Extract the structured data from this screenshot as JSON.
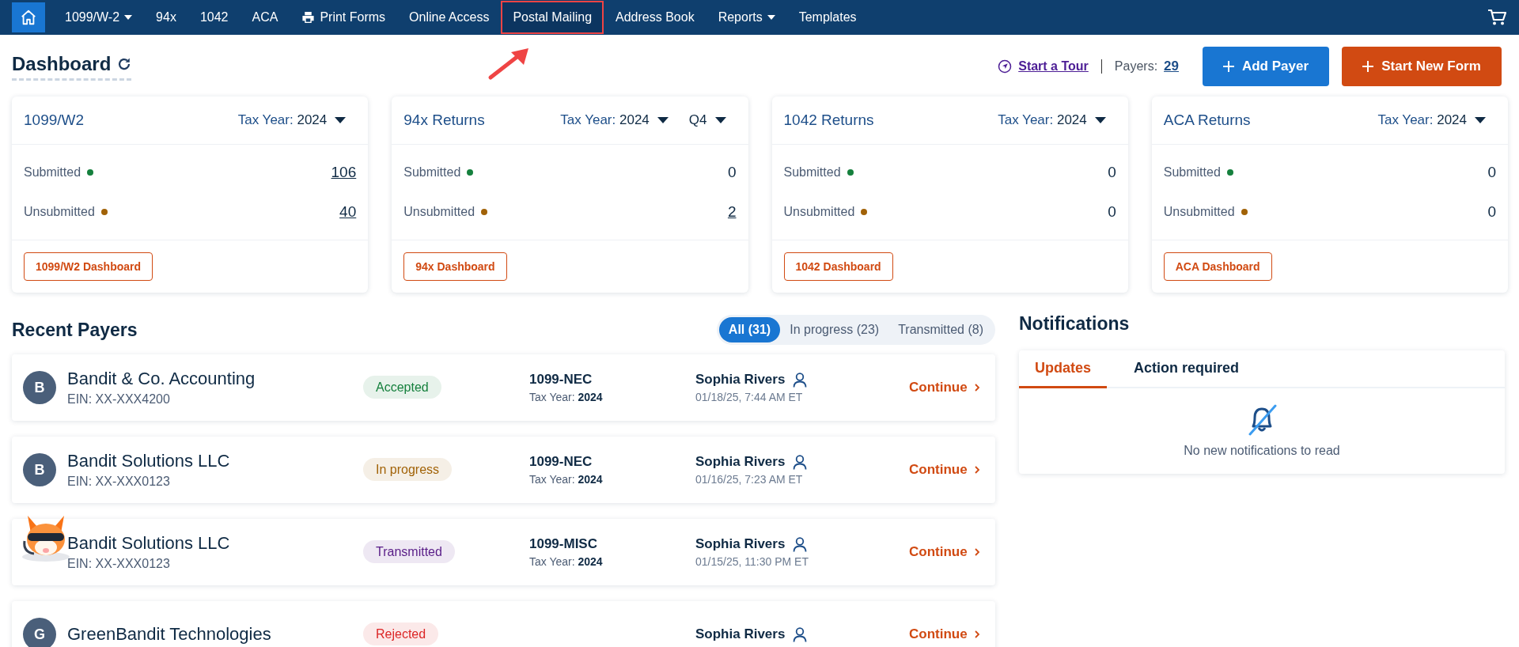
{
  "nav": {
    "items": [
      {
        "label": "1099/W-2",
        "dropdown": true,
        "kind": "text",
        "highlighted": false
      },
      {
        "label": "94x",
        "dropdown": false,
        "kind": "text",
        "highlighted": false
      },
      {
        "label": "1042",
        "dropdown": false,
        "kind": "text",
        "highlighted": false
      },
      {
        "label": "ACA",
        "dropdown": false,
        "kind": "text",
        "highlighted": false
      },
      {
        "label": "Print Forms",
        "dropdown": false,
        "kind": "print",
        "highlighted": false
      },
      {
        "label": "Online Access",
        "dropdown": false,
        "kind": "text",
        "highlighted": false
      },
      {
        "label": "Postal Mailing",
        "dropdown": false,
        "kind": "text",
        "highlighted": true
      },
      {
        "label": "Address Book",
        "dropdown": false,
        "kind": "text",
        "highlighted": false
      },
      {
        "label": "Reports",
        "dropdown": true,
        "kind": "text",
        "highlighted": false
      },
      {
        "label": "Templates",
        "dropdown": false,
        "kind": "text",
        "highlighted": false
      }
    ]
  },
  "header": {
    "title": "Dashboard",
    "tour": "Start a Tour",
    "payers_label": "Payers:",
    "payers_count": "29",
    "buttons": [
      {
        "label": "Add Payer",
        "kind": "primary"
      },
      {
        "label": "Start New Form",
        "kind": "accent"
      }
    ]
  },
  "cards": [
    {
      "title": "1099/W2",
      "selectors": [
        {
          "label": "Tax Year:",
          "value": "2024"
        }
      ],
      "stats": [
        {
          "label": "Submitted",
          "color": "#15803d",
          "value": "106",
          "link": true
        },
        {
          "label": "Unsubmitted",
          "color": "#a16207",
          "value": "40",
          "link": true
        }
      ],
      "button": "1099/W2 Dashboard"
    },
    {
      "title": "94x Returns",
      "selectors": [
        {
          "label": "Tax Year:",
          "value": "2024"
        },
        {
          "value": "Q4"
        }
      ],
      "stats": [
        {
          "label": "Submitted",
          "color": "#15803d",
          "value": "0",
          "link": false
        },
        {
          "label": "Unsubmitted",
          "color": "#a16207",
          "value": "2",
          "link": true
        }
      ],
      "button": "94x Dashboard"
    },
    {
      "title": "1042 Returns",
      "selectors": [
        {
          "label": "Tax Year:",
          "value": "2024"
        }
      ],
      "stats": [
        {
          "label": "Submitted",
          "color": "#15803d",
          "value": "0",
          "link": false
        },
        {
          "label": "Unsubmitted",
          "color": "#a16207",
          "value": "0",
          "link": false
        }
      ],
      "button": "1042 Dashboard"
    },
    {
      "title": "ACA Returns",
      "selectors": [
        {
          "label": "Tax Year:",
          "value": "2024"
        }
      ],
      "stats": [
        {
          "label": "Submitted",
          "color": "#15803d",
          "value": "0",
          "link": false
        },
        {
          "label": "Unsubmitted",
          "color": "#a16207",
          "value": "0",
          "link": false
        }
      ],
      "button": "ACA Dashboard"
    }
  ],
  "recent": {
    "title": "Recent Payers",
    "filters": [
      {
        "label": "All (31)",
        "selected": true
      },
      {
        "label": "In progress (23)",
        "selected": false
      },
      {
        "label": "Transmitted (8)",
        "selected": false
      }
    ],
    "rows": [
      {
        "avatar": {
          "kind": "letter",
          "letter": "B"
        },
        "name": "Bandit & Co. Accounting",
        "ein": "EIN: XX-XXX4200",
        "status": {
          "label": "Accepted",
          "color": "#15803d"
        },
        "form": "1099-NEC",
        "tax_year": "Tax Year: **2024**",
        "user": "Sophia Rivers",
        "date": "01/18/25, 7:44 AM ET",
        "action": "Continue"
      },
      {
        "avatar": {
          "kind": "letter",
          "letter": "B"
        },
        "name": "Bandit Solutions LLC",
        "ein": "EIN: XX-XXX0123",
        "status": {
          "label": "In progress",
          "color": "#a16207"
        },
        "form": "1099-NEC",
        "tax_year": "Tax Year: **2024**",
        "user": "Sophia Rivers",
        "date": "01/16/25, 7:23 AM ET",
        "action": "Continue"
      },
      {
        "name": "Bandit Solutions LLC",
        "ein": "EIN: XX-XXX0123",
        "status": {
          "label": "Transmitted",
          "color": "#581c87"
        },
        "form": "1099-MISC",
        "tax_year": "Tax Year: **2024**",
        "user": "Sophia Rivers",
        "date": "01/15/25, 11:30 PM ET",
        "action": "Continue"
      },
      {
        "avatar": {
          "kind": "letter",
          "letter": "G"
        },
        "name": "GreenBandit Technologies",
        "status": {
          "label": "Rejected",
          "color": "#dc2626"
        },
        "user": "Sophia Rivers",
        "action": "Continue"
      }
    ]
  },
  "notifications": {
    "title": "Notifications",
    "tabs": [
      {
        "label": "Updates",
        "selected": true
      },
      {
        "label": "Action required",
        "selected": false
      }
    ],
    "empty": "No new notifications to read"
  }
}
